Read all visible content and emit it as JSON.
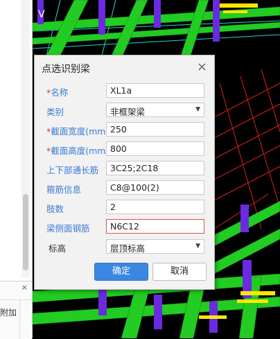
{
  "dialog": {
    "title": "点选识别梁",
    "close_glyph": "×",
    "fields": [
      {
        "label": "名称",
        "required": true,
        "value": "XL1a",
        "type": "text"
      },
      {
        "label": "类别",
        "required": false,
        "value": "非框架梁",
        "type": "select"
      },
      {
        "label": "截面宽度(mm)",
        "required": true,
        "value": "250",
        "type": "text"
      },
      {
        "label": "截面高度(mm)",
        "required": true,
        "value": "800",
        "type": "text"
      },
      {
        "label": "上下部通长筋",
        "required": false,
        "value": "3C25;2C18",
        "type": "text"
      },
      {
        "label": "箍筋信息",
        "required": false,
        "value": "C8@100(2)",
        "type": "text"
      },
      {
        "label": "肢数",
        "required": false,
        "value": "2",
        "type": "text"
      },
      {
        "label": "梁侧面钢筋",
        "required": false,
        "value": "N6C12",
        "type": "text",
        "error": true
      },
      {
        "label": "标高",
        "required": false,
        "value": "层顶标高",
        "type": "select"
      }
    ],
    "required_mark": "*",
    "ok_label": "确定",
    "cancel_label": "取消"
  },
  "left_panel": {
    "bottom_text": "附加",
    "close_glyph": "×",
    "side_letter": "V"
  },
  "colors": {
    "beam_green": "#22cc22",
    "column_purple": "#6a2be0",
    "grid_red": "#e02020",
    "text_yellow": "#ffe600",
    "accent_blue": "#3b86e0",
    "label_blue": "#3a7bd5",
    "error_red": "#d9534f"
  }
}
